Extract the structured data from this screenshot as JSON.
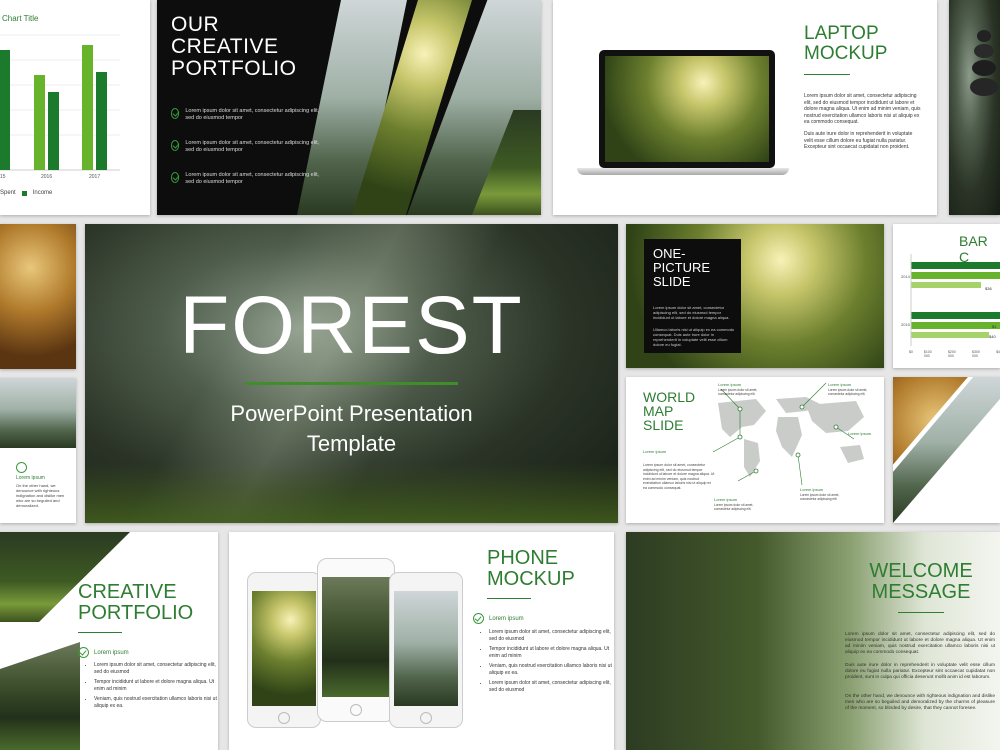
{
  "bar_slide": {
    "chart_title": "Chart Title",
    "years": [
      "15",
      "2016",
      "2017"
    ],
    "legend": [
      "Spent",
      "Income"
    ],
    "colors": {
      "spent": "#1b7a2b",
      "income": "#68b32c"
    }
  },
  "portfolio": {
    "title": [
      "OUR",
      "CREATIVE",
      "PORTFOLIO"
    ],
    "items": [
      "Lorem ipsum dolor sit amet, consectetur adipiscing elit, sed do eiusmod tempor",
      "Lorem ipsum dolor sit amet, consectetur adipiscing elit, sed do eiusmod tempor",
      "Lorem ipsum dolor sit amet, consectetur adipiscing elit, sed do eiusmod tempor"
    ]
  },
  "laptop": {
    "title": [
      "LAPTOP",
      "MOCKUP"
    ],
    "para1": "Lorem ipsum dolor sit amet, consectetur adipiscing elit, sed do eiusmod tempor incididunt ut labore et dolore magna aliqua. Ut enim ad minim veniam, quis nostrud exercitation ullamco laboris nisi ut aliquip ex ea commodo consequat.",
    "para2": "Duis aute irure dolor in reprehenderit in voluptate velit esse cillum dolore eu fugiat nulla pariatur. Excepteur sint occaecat cupidatat non proident."
  },
  "hero": {
    "title": "FOREST",
    "subtitle_1": "PowerPoint Presentation",
    "subtitle_2": "Template"
  },
  "one_picture": {
    "title": [
      "ONE-",
      "PICTURE",
      "SLIDE"
    ],
    "para1": "Lorem ipsum dolor sit amet, consectetur adipiscing elit, sed do eiusmod tempor incididunt ut labore et dolore magna aliqua.",
    "para2": "Ullamco laboris nisi ut aliquip ex ea commodo consequat. Duis aute irure dolor in reprehenderit in voluptate velit esse cillum dolore eu fugiat."
  },
  "bar_chart_slide": {
    "title": "BAR C",
    "row_labels": [
      "2014",
      "2015"
    ],
    "axis": [
      "$0",
      "$100 000",
      "$200 000",
      "$300 000",
      "$4"
    ],
    "values_labels": [
      "$36",
      "$1",
      "$40"
    ]
  },
  "world_map": {
    "title": [
      "WORLD",
      "MAP",
      "SLIDE"
    ],
    "label": "Lorem ipsum",
    "left_text": "Lorem ipsum dolor sit amet, consectetur adipiscing elit, sed do eiusmod tempor incididunt ut labore et dolore magna aliqua. Ut enim ad minim veniam, quis nostrud exercitation ullamco laboris nisi ut aliquip ex ea commodo consequat.",
    "callout_text": "Lorem ipsum dolor sit amet, consectetur adipiscing elit."
  },
  "lorem_small": {
    "label": "Lorem ipsum",
    "text": "On the other hand, we denounce with righteous indignation and dislike men who are so beguiled and demoralized."
  },
  "creative_portfolio": {
    "title": [
      "CREATIVE",
      "PORTFOLIO"
    ],
    "check_label": "Lorem ipsum",
    "items": [
      "Lorem ipsum dolor sit amet, consectetur adipiscing elit, sed do eiusmod",
      "Tempor incididunt ut labore et dolore magna aliqua. Ut enim ad minim",
      "Veniam, quis nostrud exercitation ullamco laboris nisi ut aliquip ex ea."
    ]
  },
  "phone": {
    "title": [
      "PHONE",
      "MOCKUP"
    ],
    "check_label": "Lorem ipsum",
    "items": [
      "Lorem ipsum dolor sit amet, consectetur adipiscing elit, sed do eiusmod",
      "Tempor incididunt ut labore et dolore magna aliqua. Ut enim ad minim",
      "Veniam, quis nostrud exercitation ullamco laboris nisi ut aliquip ex ea.",
      "Lorem ipsum dolor sit amet, consectetur adipiscing elit, sed do eiusmod"
    ]
  },
  "welcome": {
    "title": [
      "WELCOME",
      "MESSAGE"
    ],
    "para1": "Lorem ipsum dolor sit amet, consectetur adipiscing elit, sed do eiusmod tempor incididunt ut labore et dolore magna aliqua. Ut enim ad minim veniam, quis nostrud exercitation ullamco laboris nisi ut aliquip ex ea commodo consequat.",
    "para2": "Duis aute irure dolor in reprehenderit in voluptate velit esse cillum dolore eu fugiat nulla pariatur. Excepteur sint occaecat cupidatat non proident, sunt in culpa qui officia deserunt mollit anim id est laborum.",
    "para3": "On the other hand, we denounce with righteous indignation and dislike men who are so beguiled and demoralized by the charms of pleasure of the moment, so blinded by desire, that they cannot foresee."
  },
  "colors": {
    "accent": "#2e7d32",
    "dark": "#111111"
  }
}
